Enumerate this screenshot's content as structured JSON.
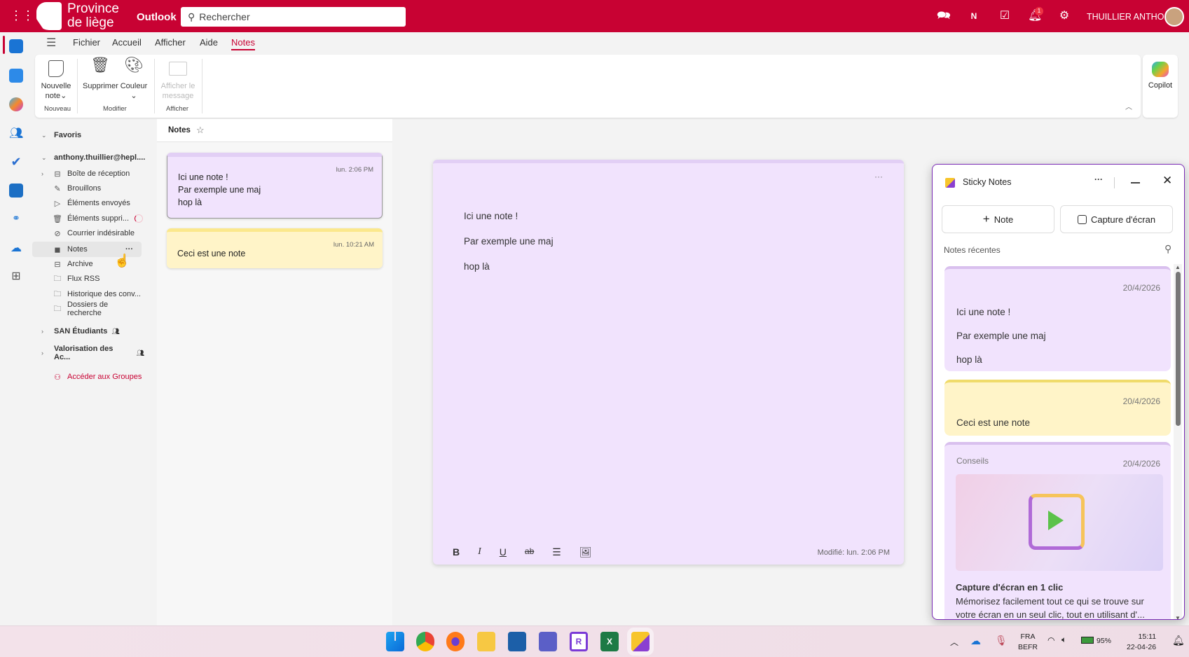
{
  "topbar": {
    "org_line1": "Province",
    "org_line2": "de liège",
    "app": "Outlook",
    "search_placeholder": "Rechercher",
    "user": "THUILLIER ANTHO...",
    "notif_count": "1"
  },
  "menu": {
    "tabs": [
      "Fichier",
      "Accueil",
      "Afficher",
      "Aide",
      "Notes"
    ],
    "active": "Notes"
  },
  "ribbon": {
    "new_note_1": "Nouvelle",
    "new_note_2": "note",
    "delete": "Supprimer",
    "color": "Couleur",
    "show_msg_1": "Afficher le",
    "show_msg_2": "message",
    "group_new": "Nouveau",
    "group_modify": "Modifier",
    "group_show": "Afficher",
    "copilot": "Copilot"
  },
  "folders": {
    "favorites": "Favoris",
    "account": "anthony.thuillier@hepl....",
    "items": [
      {
        "label": "Boîte de réception",
        "icon": "inbox-icon"
      },
      {
        "label": "Brouillons",
        "icon": "drafts-icon"
      },
      {
        "label": "Éléments envoyés",
        "icon": "send-icon"
      },
      {
        "label": "Éléments suppri...",
        "icon": "trash-icon"
      },
      {
        "label": "Courrier indésirable",
        "icon": "junk-icon"
      },
      {
        "label": "Notes",
        "icon": "note-icon"
      },
      {
        "label": "Archive",
        "icon": "archive-icon"
      },
      {
        "label": "Flux RSS",
        "icon": "folder-icon"
      },
      {
        "label": "Historique des conv...",
        "icon": "folder-icon"
      },
      {
        "label": "Dossiers de recherche",
        "icon": "search-folder-icon"
      }
    ],
    "groups": [
      "SAN Étudiants",
      "Valorisation des Ac..."
    ],
    "groups_link": "Accéder aux Groupes"
  },
  "notes_list": {
    "title": "Notes",
    "notes": [
      {
        "time": "lun. 2:06 PM",
        "lines": [
          "Ici une note !",
          "Par exemple une maj",
          "hop là"
        ],
        "color": "#f1e3fd"
      },
      {
        "time": "lun. 10:21 AM",
        "lines": [
          "Ceci est une note"
        ],
        "color": "#fff4c8"
      }
    ]
  },
  "editor": {
    "lines": [
      "Ici une note !",
      "Par exemple une maj",
      "hop là"
    ],
    "modified": "Modifié: lun. 2:06 PM"
  },
  "sticky": {
    "title": "Sticky Notes",
    "new_note": "Note",
    "capture": "Capture d'écran",
    "recent": "Notes récentes",
    "notes": [
      {
        "date": "20/4/2026",
        "lines": [
          "Ici une note !",
          "Par exemple une maj",
          "hop là"
        ]
      },
      {
        "date": "20/4/2026",
        "lines": [
          "Ceci est une note"
        ]
      }
    ],
    "tip": {
      "label": "Conseils",
      "date": "20/4/2026",
      "title": "Capture d'écran en 1 clic",
      "body": "Mémorisez facilement tout ce qui se trouve sur votre écran en un seul clic, tout en utilisant d'..."
    }
  },
  "taskbar": {
    "lang1": "FRA",
    "lang2": "BEFR",
    "battery": "95%",
    "time": "15:11",
    "date": "22-04-26"
  },
  "colors": {
    "brand": "#c80233",
    "purple_note": "#f1e3fd",
    "yellow_note": "#fff4c8"
  }
}
